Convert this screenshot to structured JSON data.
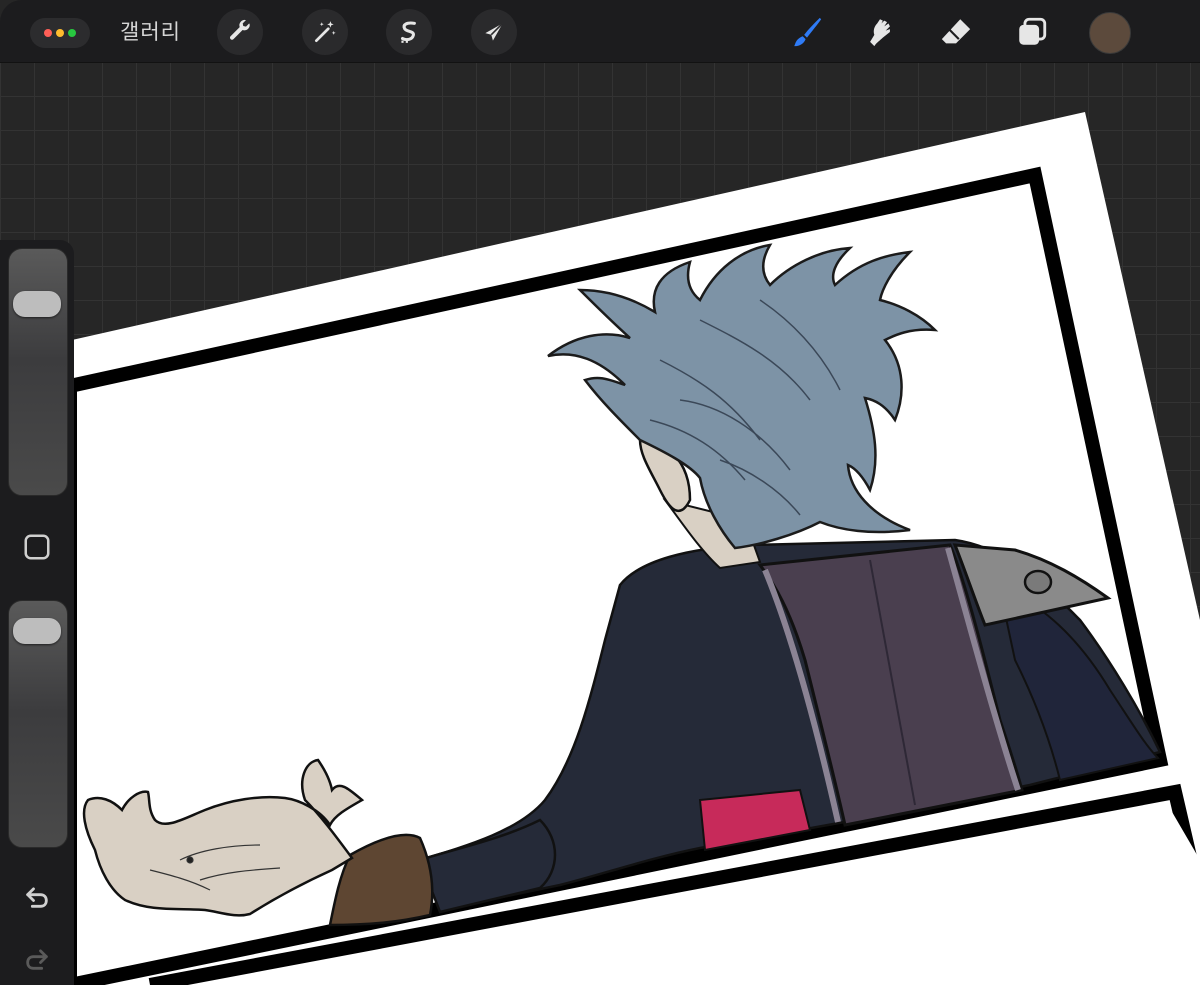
{
  "toolbar": {
    "gallery_label": "갤러리",
    "menu_dot_colors": [
      "#ff5f57",
      "#febc2e",
      "#28c840"
    ],
    "tools_left": [
      {
        "icon": "wrench-icon",
        "name": "actions"
      },
      {
        "icon": "magic-wand-icon",
        "name": "adjustments"
      },
      {
        "icon": "selection-s-icon",
        "name": "selection"
      },
      {
        "icon": "arrow-cursor-icon",
        "name": "transform"
      }
    ],
    "tools_right": [
      {
        "icon": "brush-icon",
        "name": "paint",
        "active": true
      },
      {
        "icon": "smudge-icon",
        "name": "smudge",
        "active": false
      },
      {
        "icon": "eraser-icon",
        "name": "erase",
        "active": false
      },
      {
        "icon": "layers-icon",
        "name": "layers",
        "active": false
      }
    ],
    "current_color": "#5c4a3c",
    "active_color": "#2f7bf6"
  },
  "sidebar": {
    "brush_size_slider": {
      "value": 0.18
    },
    "modify_button": {
      "icon": "square-icon"
    },
    "opacity_slider": {
      "value": 0.06
    },
    "undo": {
      "icon": "undo-arrow-icon"
    },
    "redo": {
      "icon": "redo-arrow-icon"
    }
  },
  "canvas": {
    "background_color": "#262626",
    "grid_color": "#333333",
    "artwork": {
      "page_color": "#ffffff",
      "panel_border_color": "#000000",
      "hair_color": "#7d93a6",
      "skin_color": "#d9d0c4",
      "coat_color": "#252a38",
      "vest_color": "#4a3f4f",
      "shoulder_plate_color": "#8a8a8a",
      "shirt_color": "#c72a5a",
      "cuff_color": "#5e4632"
    }
  }
}
